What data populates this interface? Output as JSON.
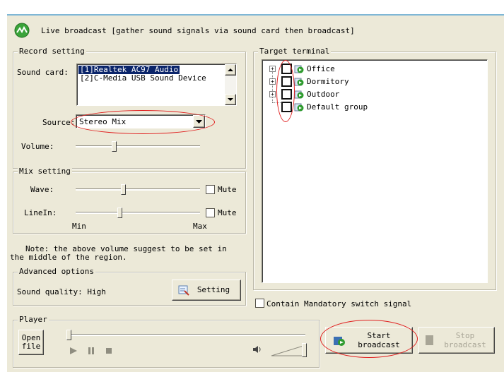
{
  "title": "Live broadcast [gather sound signals via sound card then broadcast]",
  "record": {
    "group_label": "Record setting",
    "soundcard_label": "Sound card:",
    "devices": [
      "[1]Realtek AC97 Audio",
      "[2]C-Media USB Sound Device"
    ],
    "selected_device": 0,
    "source_label": "Source:",
    "source_value": "Stereo Mix",
    "volume_label": "Volume:",
    "volume_level": 0.3
  },
  "mix": {
    "group_label": "Mix setting",
    "wave_label": "Wave:",
    "wave_level": 0.38,
    "linein_label": "LineIn:",
    "linein_level": 0.35,
    "mute_label": "Mute",
    "min_label": "Min",
    "max_label": "Max"
  },
  "note": "Note: the above volume suggest to be set in the middle of the region.",
  "advanced": {
    "group_label": "Advanced options",
    "quality_label": "Sound quality: High",
    "setting_button": "Setting"
  },
  "target": {
    "group_label": "Target terminal",
    "items": [
      "Office",
      "Dormitory",
      "Outdoor",
      "Default group"
    ],
    "contain_label": "Contain Mandatory switch signal"
  },
  "player": {
    "group_label": "Player",
    "open_file": "Open\nfile",
    "seek_level": 0.0,
    "volume_level": 1.0
  },
  "actions": {
    "start": "Start\nbroadcast",
    "stop": "Stop\nbroadcast"
  },
  "colors": {
    "selection": "#0a246a",
    "annotation": "#e01e1e",
    "dialog": "#ece9d8"
  }
}
